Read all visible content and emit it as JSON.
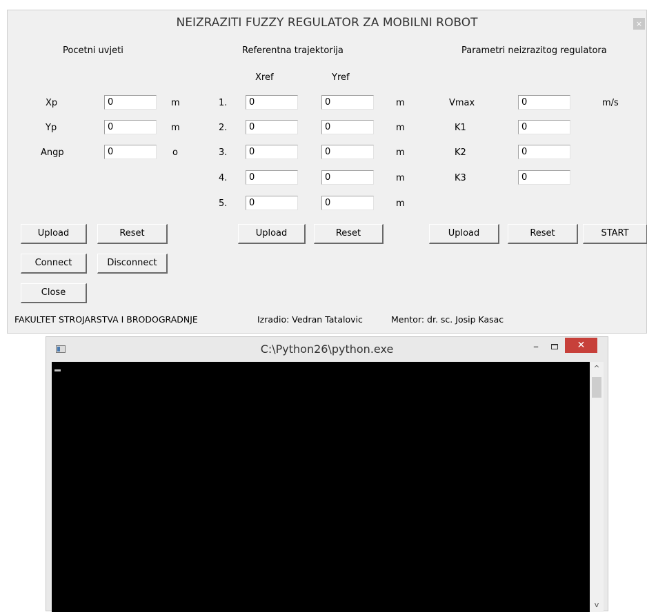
{
  "window": {
    "title": "NEIZRAZITI FUZZY REGULATOR ZA MOBILNI ROBOT",
    "close_glyph": "×"
  },
  "initial": {
    "heading": "Pocetni uvjeti",
    "xp_label": "Xp",
    "xp_value": "0",
    "xp_unit": "m",
    "yp_label": "Yp",
    "yp_value": "0",
    "yp_unit": "m",
    "angp_label": "Angp",
    "angp_value": "0",
    "angp_unit": "o",
    "upload_label": "Upload",
    "reset_label": "Reset",
    "connect_label": "Connect",
    "disconnect_label": "Disconnect",
    "close_label": "Close"
  },
  "trajectory": {
    "heading": "Referentna trajektorija",
    "xref_header": "Xref",
    "yref_header": "Yref",
    "rows": [
      {
        "num": "1.",
        "x": "0",
        "y": "0",
        "unit": "m"
      },
      {
        "num": "2.",
        "x": "0",
        "y": "0",
        "unit": "m"
      },
      {
        "num": "3.",
        "x": "0",
        "y": "0",
        "unit": "m"
      },
      {
        "num": "4.",
        "x": "0",
        "y": "0",
        "unit": "m"
      },
      {
        "num": "5.",
        "x": "0",
        "y": "0",
        "unit": "m"
      }
    ],
    "upload_label": "Upload",
    "reset_label": "Reset"
  },
  "params": {
    "heading": "Parametri neizrazitog regulatora",
    "vmax_label": "Vmax",
    "vmax_value": "0",
    "vmax_unit": "m/s",
    "k1_label": "K1",
    "k1_value": "0",
    "k2_label": "K2",
    "k2_value": "0",
    "k3_label": "K3",
    "k3_value": "0",
    "upload_label": "Upload",
    "reset_label": "Reset",
    "start_label": "START"
  },
  "footer": {
    "faculty": "FAKULTET STROJARSTVA I BRODOGRADNJE",
    "author": "Izradio: Vedran Tatalovic",
    "mentor": "Mentor: dr. sc. Josip Kasac"
  },
  "console": {
    "title": "C:\\Python26\\python.exe",
    "minimize_glyph": "–",
    "close_glyph": "✕",
    "scroll_up_glyph": "^",
    "scroll_down_glyph": "v"
  }
}
